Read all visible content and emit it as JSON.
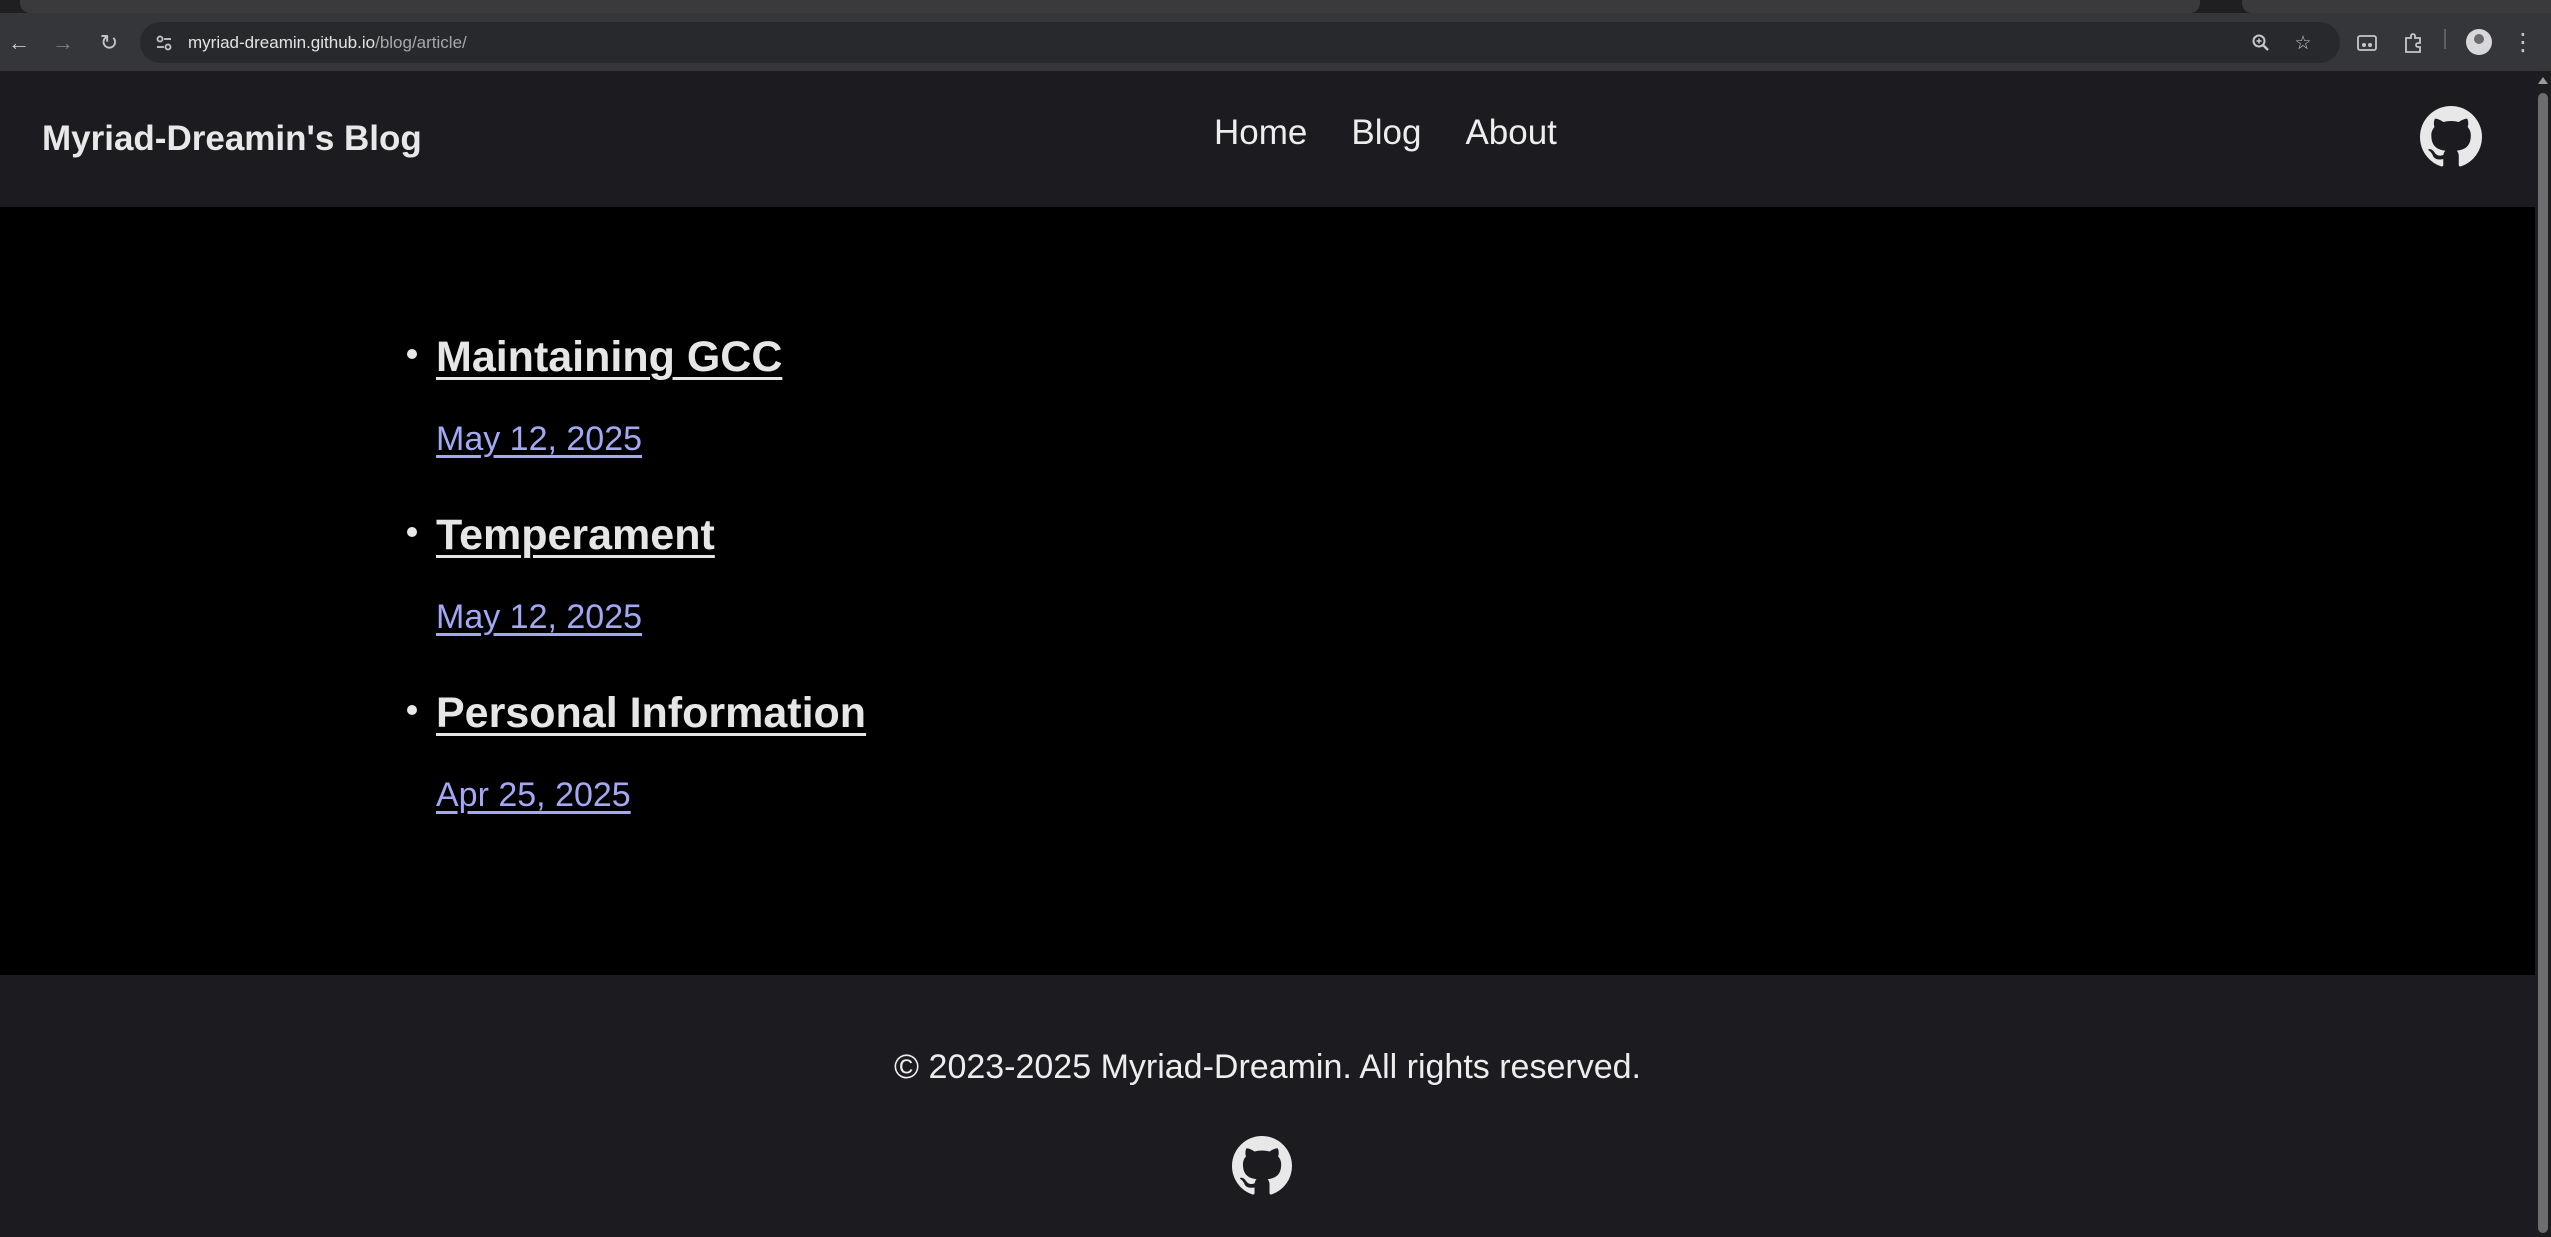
{
  "browser": {
    "url_host": "myriad-dreamin.github.io",
    "url_path": "/blog/article/",
    "icons": {
      "back": "back-arrow-icon",
      "forward": "forward-arrow-icon",
      "reload": "reload-icon",
      "site_info": "site-info-icon",
      "zoom": "zoom-icon",
      "bookmark": "star-icon",
      "reading_mode": "reading-mode-icon",
      "extensions": "puzzle-icon",
      "profile": "avatar-icon",
      "menu": "kebab-menu-icon"
    }
  },
  "header": {
    "site_title": "Myriad-Dreamin's Blog",
    "nav": [
      {
        "label": "Home"
      },
      {
        "label": "Blog"
      },
      {
        "label": "About"
      }
    ]
  },
  "articles": [
    {
      "title": "Maintaining GCC",
      "date": "May 12, 2025"
    },
    {
      "title": "Temperament",
      "date": "May 12, 2025"
    },
    {
      "title": "Personal Information",
      "date": "Apr 25, 2025"
    }
  ],
  "footer": {
    "copyright": "© 2023-2025 Myriad-Dreamin. All rights reserved."
  },
  "colors": {
    "header_bg": "#1c1c20",
    "main_bg": "#000000",
    "date_link": "#a3a8f5",
    "title_text": "#e6e6e6"
  }
}
